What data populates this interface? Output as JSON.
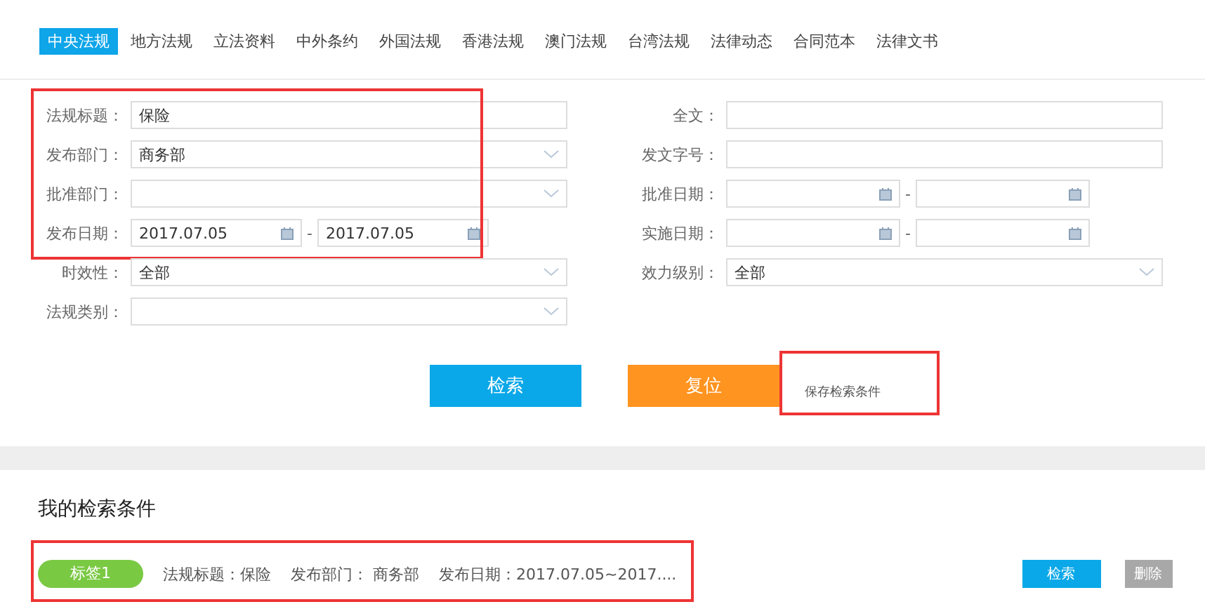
{
  "tabs": [
    {
      "label": "中央法规",
      "selected": true
    },
    {
      "label": "地方法规",
      "selected": false
    },
    {
      "label": "立法资料",
      "selected": false
    },
    {
      "label": "中外条约",
      "selected": false
    },
    {
      "label": "外国法规",
      "selected": false
    },
    {
      "label": "香港法规",
      "selected": false
    },
    {
      "label": "澳门法规",
      "selected": false
    },
    {
      "label": "台湾法规",
      "selected": false
    },
    {
      "label": "法律动态",
      "selected": false
    },
    {
      "label": "合同范本",
      "selected": false
    },
    {
      "label": "法律文书",
      "selected": false
    }
  ],
  "form": {
    "left": [
      {
        "highlighted": true,
        "fields": [
          {
            "kind": "text",
            "label": "法规标题：",
            "value": "保险"
          },
          {
            "kind": "select",
            "label": "发布部门：",
            "value": "商务部"
          },
          {
            "kind": "select",
            "label": "批准部门："
          },
          {
            "kind": "daterange",
            "label": "发布日期：",
            "from": "2017.07.05",
            "separator": "-",
            "to": "2017.07.05"
          }
        ]
      },
      {
        "highlighted": false,
        "fields": [
          {
            "kind": "select",
            "label": "时效性：",
            "value": "全部"
          },
          {
            "kind": "select",
            "label": "法规类别："
          }
        ]
      }
    ],
    "right": [
      {
        "kind": "text",
        "label": "全文："
      },
      {
        "kind": "text",
        "label": "发文字号："
      },
      {
        "kind": "daterange",
        "label": "批准日期：",
        "separator": "-"
      },
      {
        "kind": "daterange",
        "label": "实施日期：",
        "separator": "-"
      },
      {
        "kind": "select",
        "label": "效力级别：",
        "value": "全部"
      }
    ]
  },
  "actions": {
    "search": "检索",
    "reset": "复位",
    "save_popup": {
      "label": "保存检索条件",
      "highlighted": true
    }
  },
  "saved": {
    "title": "我的检索条件",
    "highlighted": true,
    "items": [
      {
        "tag": "标签1",
        "color": "#7ac943",
        "conditions": [
          "法规标题：保险",
          "发布部门： 商务部",
          "发布日期：2017.07.05~2017...."
        ],
        "search": "检索",
        "delete": "删除"
      }
    ]
  }
}
